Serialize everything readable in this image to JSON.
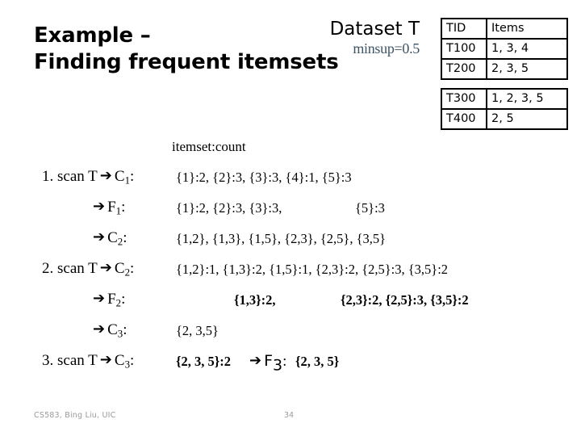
{
  "slide": {
    "title_lines": [
      "Example –",
      "Finding frequent itemsets"
    ],
    "dataset_label": "Dataset T",
    "minsup": "minsup=0.5",
    "minsup_color": "#3d5566",
    "itemset_count_label": "itemset:count",
    "arrow_glyph": "➔"
  },
  "table": {
    "headers": [
      "TID",
      "Items"
    ],
    "rows_group_1": [
      {
        "tid": "T100",
        "items": "1, 3, 4"
      },
      {
        "tid": "T200",
        "items": "2, 3, 5"
      }
    ],
    "rows_group_2": [
      {
        "tid": "T300",
        "items": "1, 2, 3, 5"
      },
      {
        "tid": "T400",
        "items": "2, 5"
      }
    ]
  },
  "steps": {
    "scan1": {
      "prefix": "1. scan T",
      "label": "C",
      "sub": "1",
      "colon": ":",
      "values": "{1}:2, {2}:3, {3}:3, {4}:1, {5}:3"
    },
    "f1": {
      "label": "F",
      "sub": "1",
      "colon": ":",
      "values_a": "{1}:2, {2}:3, {3}:3,",
      "values_b": "{5}:3"
    },
    "c2": {
      "label": "C",
      "sub": "2",
      "colon": ":",
      "values": "{1,2}, {1,3}, {1,5}, {2,3}, {2,5}, {3,5}"
    },
    "scan2": {
      "prefix": "2. scan T",
      "label": "C",
      "sub": "2",
      "colon": ":",
      "values": "{1,2}:1, {1,3}:2, {1,5}:1, {2,3}:2, {2,5}:3, {3,5}:2"
    },
    "f2": {
      "label": "F",
      "sub": "2",
      "colon": ":",
      "values_a": "{1,3}:2,",
      "values_b": "{2,3}:2, {2,5}:3, {3,5}:2"
    },
    "c3": {
      "label": "C",
      "sub": "3",
      "colon": ":",
      "values": "{2, 3,5}"
    },
    "scan3": {
      "prefix": "3. scan T",
      "label": "C",
      "sub": "3",
      "colon": ":",
      "values": "{2, 3, 5}:2",
      "result_label": "F",
      "result_sub": "3",
      "result_colon": ":",
      "result_values": "{2, 3, 5}"
    }
  },
  "footer": {
    "credit": "CS583, Bing Liu, UIC",
    "page": "34"
  }
}
